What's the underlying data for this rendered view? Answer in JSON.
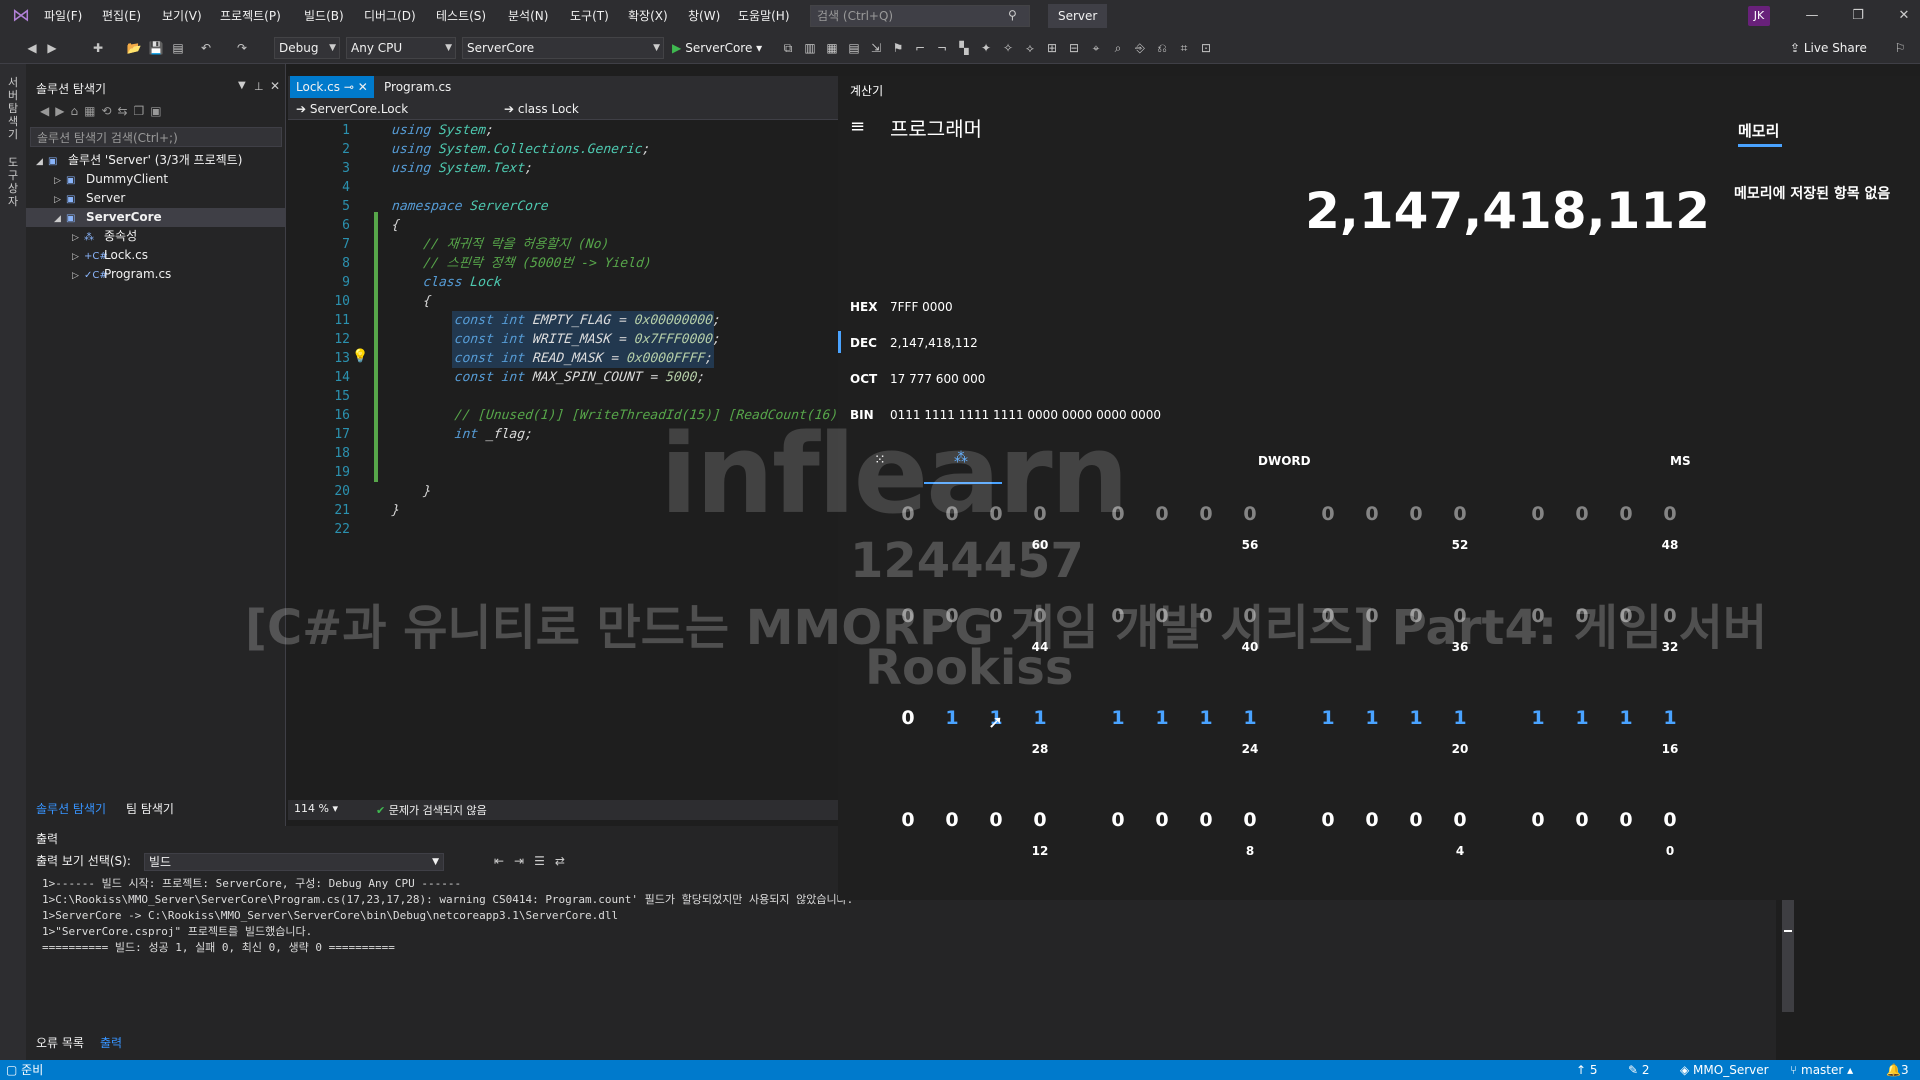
{
  "menu": [
    "파일(F)",
    "편집(E)",
    "보기(V)",
    "프로젝트(P)",
    "빌드(B)",
    "디버그(D)",
    "테스트(S)",
    "분석(N)",
    "도구(T)",
    "확장(X)",
    "창(W)",
    "도움말(H)"
  ],
  "search": {
    "placeholder": "검색 (Ctrl+Q)"
  },
  "solution_name": "Server",
  "user_initials": "JK",
  "toolbar": {
    "config": "Debug",
    "platform": "Any CPU",
    "startup_project": "ServerCore",
    "run_label": "ServerCore",
    "live_share": "Live Share"
  },
  "left_rail": [
    "서버 탐색기",
    "도구 상자"
  ],
  "solution_explorer": {
    "title": "솔루션 탐색기",
    "search_placeholder": "솔루션 탐색기 검색(Ctrl+;)",
    "tree": [
      {
        "label": "솔루션 'Server' (3/3개 프로젝트)",
        "indent": 0,
        "arrow": "◢",
        "icon": "▣",
        "selected": false
      },
      {
        "label": "DummyClient",
        "indent": 1,
        "arrow": "▷",
        "icon": "▣",
        "selected": false
      },
      {
        "label": "Server",
        "indent": 1,
        "arrow": "▷",
        "icon": "▣",
        "selected": false
      },
      {
        "label": "ServerCore",
        "indent": 1,
        "arrow": "◢",
        "icon": "▣",
        "selected": true
      },
      {
        "label": "종속성",
        "indent": 2,
        "arrow": "▷",
        "icon": "⁂",
        "selected": false
      },
      {
        "label": "Lock.cs",
        "indent": 2,
        "arrow": "▷",
        "icon": "+C#",
        "selected": false
      },
      {
        "label": "Program.cs",
        "indent": 2,
        "arrow": "▷",
        "icon": "✓C#",
        "selected": false
      }
    ],
    "tabs": [
      "솔루션 탐색기",
      "팀 탐색기"
    ]
  },
  "editor": {
    "tabs": [
      "Lock.cs",
      "Program.cs"
    ],
    "nav_left": "ServerCore.Lock",
    "nav_right": "class Lock",
    "zoom": "114 %",
    "issues": "문제가 검색되지 않음",
    "lines": [
      [
        [
          "kw",
          "using "
        ],
        [
          "ty",
          "System"
        ],
        [
          "tx",
          ";"
        ]
      ],
      [
        [
          "kw",
          "using "
        ],
        [
          "ty",
          "System.Collections.Generic"
        ],
        [
          "tx",
          ";"
        ]
      ],
      [
        [
          "kw",
          "using "
        ],
        [
          "ty",
          "System.Text"
        ],
        [
          "tx",
          ";"
        ]
      ],
      [],
      [
        [
          "kw",
          "namespace "
        ],
        [
          "ty",
          "ServerCore"
        ]
      ],
      [
        [
          "tx",
          "{"
        ]
      ],
      [
        [
          "tx",
          "    "
        ],
        [
          "cm",
          "// 재귀적 락을 허용할지 (No)"
        ]
      ],
      [
        [
          "tx",
          "    "
        ],
        [
          "cm",
          "// 스핀락 정책 (5000번 -> Yield)"
        ]
      ],
      [
        [
          "tx",
          "    "
        ],
        [
          "kw",
          "class "
        ],
        [
          "ty",
          "Lock"
        ]
      ],
      [
        [
          "tx",
          "    {"
        ]
      ],
      [
        [
          "tx",
          "        "
        ],
        [
          "kw",
          "const int "
        ],
        [
          "ident",
          "EMPTY_FLAG"
        ],
        [
          "tx",
          " = "
        ],
        [
          "nm",
          "0x00000000"
        ],
        [
          "tx",
          ";"
        ]
      ],
      [
        [
          "tx",
          "        "
        ],
        [
          "kw",
          "const int "
        ],
        [
          "ident",
          "WRITE_MASK"
        ],
        [
          "tx",
          " = "
        ],
        [
          "nm",
          "0x7FFF0000"
        ],
        [
          "tx",
          ";"
        ]
      ],
      [
        [
          "tx",
          "        "
        ],
        [
          "kw",
          "const int "
        ],
        [
          "ident",
          "READ_MASK"
        ],
        [
          "tx",
          " = "
        ],
        [
          "nm",
          "0x0000FFFF"
        ],
        [
          "tx",
          ";"
        ]
      ],
      [
        [
          "tx",
          "        "
        ],
        [
          "kw",
          "const int "
        ],
        [
          "ident",
          "MAX_SPIN_COUNT"
        ],
        [
          "tx",
          " = "
        ],
        [
          "nm",
          "5000"
        ],
        [
          "tx",
          ";"
        ]
      ],
      [],
      [
        [
          "tx",
          "        "
        ],
        [
          "cm",
          "// [Unused(1)] [WriteThreadId(15)] [ReadCount(16)]"
        ]
      ],
      [
        [
          "tx",
          "        "
        ],
        [
          "kw",
          "int "
        ],
        [
          "ident",
          "_flag"
        ],
        [
          "tx",
          ";"
        ]
      ],
      [],
      [],
      [
        [
          "tx",
          "    }"
        ]
      ],
      [
        [
          "tx",
          "}"
        ]
      ],
      []
    ]
  },
  "output": {
    "title": "출력",
    "source_label": "출력 보기 선택(S):",
    "source_value": "빌드",
    "lines": [
      "1>------ 빌드 시작: 프로젝트: ServerCore, 구성: Debug Any CPU ------",
      "1>C:\\Rookiss\\MMO_Server\\ServerCore\\Program.cs(17,23,17,28): warning CS0414: Program.count' 필드가 할당되었지만 사용되지 않았습니다.",
      "1>ServerCore -> C:\\Rookiss\\MMO_Server\\ServerCore\\bin\\Debug\\netcoreapp3.1\\ServerCore.dll",
      "1>\"ServerCore.csproj\" 프로젝트를 빌드했습니다.",
      "========== 빌드: 성공 1, 실패 0, 최신 0, 생략 0 =========="
    ],
    "tabs": [
      "오류 목록",
      "출력"
    ]
  },
  "statusbar": {
    "ready": "준비",
    "up": "5",
    "edits": "2",
    "repo": "MMO_Server",
    "branch": "master",
    "notifications": "3"
  },
  "calculator": {
    "title": "계산기",
    "mode": "프로그래머",
    "memory_tab": "메모리",
    "memory_empty": "메모리에 저장된 항목 없음",
    "display": "2,147,418,112",
    "bases": [
      {
        "label": "HEX",
        "value": "7FFF 0000"
      },
      {
        "label": "DEC",
        "value": "2,147,418,112"
      },
      {
        "label": "OCT",
        "value": "17 777 600 000"
      },
      {
        "label": "BIN",
        "value": "0111 1111 1111 1111 0000 0000 0000 0000"
      }
    ],
    "word_size": "DWORD",
    "ms_label": "MS",
    "bit_rows": [
      {
        "bits": "0000000000000000",
        "labels": [
          "60",
          "56",
          "52",
          "48"
        ],
        "faded": true
      },
      {
        "bits": "0000000000000000",
        "labels": [
          "44",
          "40",
          "36",
          "32"
        ],
        "faded": true
      },
      {
        "bits": "0111111111111111",
        "labels": [
          "28",
          "24",
          "20",
          "16"
        ],
        "faded": false
      },
      {
        "bits": "0000000000000000",
        "labels": [
          "12",
          "8",
          "4",
          "0"
        ],
        "faded": false
      }
    ]
  },
  "watermark": {
    "logo": "inflearn",
    "id": "1244457",
    "course": "[C#과 유니티로 만드는 MMORPG 게임 개발 시리즈] Part4: 게임 서버",
    "author": "Rookiss"
  },
  "colors": {
    "accent": "#007acc",
    "calc_accent": "#4aa3ff",
    "bg": "#1e1e1e"
  }
}
